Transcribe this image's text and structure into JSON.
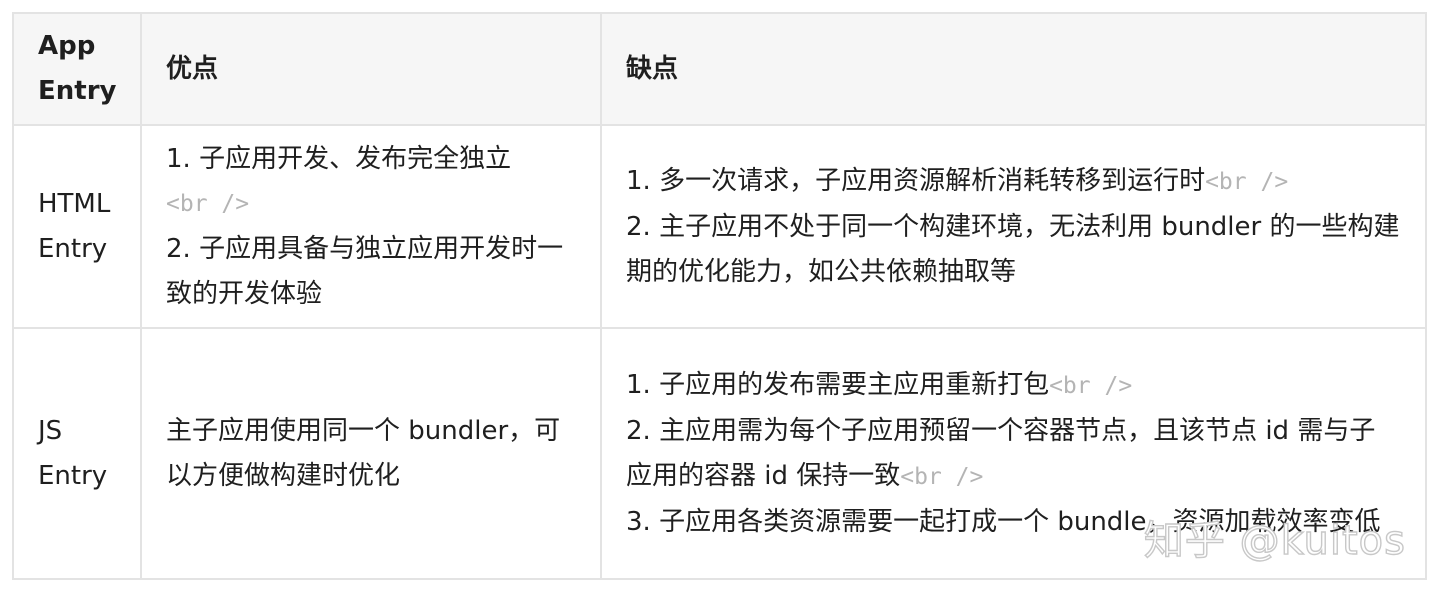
{
  "table": {
    "headers": [
      "App Entry",
      "优点",
      "缺点"
    ],
    "rows": [
      {
        "entry": "HTML Entry",
        "pros": [
          "1. 子应用开发、发布完全独立",
          "<br />",
          "2. 子应用具备与独立应用开发时一致的开发体验"
        ],
        "cons": [
          "1. 多一次请求，子应用资源解析消耗转移到运行时",
          "<br />",
          "2. 主子应用不处于同一个构建环境，无法利用 bundler 的一些构建期的优化能力，如公共依赖抽取等"
        ]
      },
      {
        "entry": "JS Entry",
        "pros": [
          "主子应用使用同一个 bundler，可以方便做构建时优化"
        ],
        "cons": [
          "1. 子应用的发布需要主应用重新打包",
          "<br />",
          "2. 主应用需为每个子应用预留一个容器节点，且该节点 id 需与子应用的容器 id 保持一致",
          "<br />",
          "3. 子应用各类资源需要一起打成一个 bundle，资源加载效率变低"
        ]
      }
    ]
  },
  "watermark": "知乎 @kuitos"
}
